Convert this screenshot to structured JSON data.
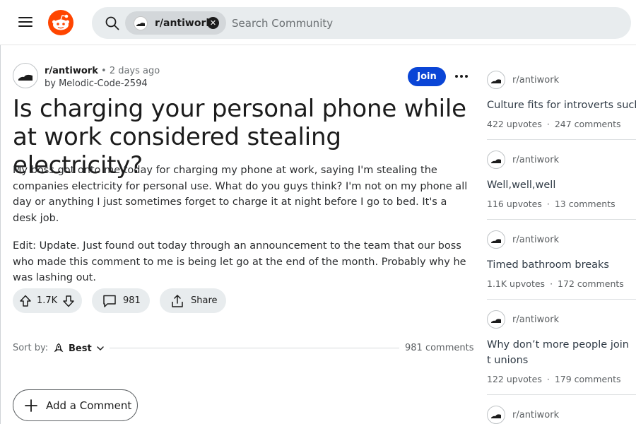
{
  "search": {
    "community_chip": "r/antiwork",
    "placeholder": "Search Community"
  },
  "post": {
    "subreddit": "r/antiwork",
    "separator": "•",
    "time": "2 days ago",
    "author": "by Melodic-Code-2594",
    "join_label": "Join",
    "title": "Is charging your personal phone while at work considered stealing electricity?",
    "body": [
      "My boss got onto me today for charging my phone at work, saying I'm stealing the companies electricity for personal use. What do you guys think? I'm not on my phone all day or anything I just sometimes forget to charge it at night before I go to bed. It's a desk job.",
      "Edit: Update. Just found out today through an announcement to the team that our boss who made this comment to me is being let go at the end of the month. Probably why he was lashing out."
    ],
    "upvotes": "1.7K",
    "comments_count": "981",
    "share_label": "Share"
  },
  "sort": {
    "label": "Sort by:",
    "value": "Best",
    "total_comments": "981 comments"
  },
  "add_comment_label": "Add a Comment",
  "related": [
    {
      "subreddit": "r/antiwork",
      "title": "Culture fits for introverts suck",
      "upvotes": "422 upvotes",
      "comments": "247 comments"
    },
    {
      "subreddit": "r/antiwork",
      "title": "Well,well,well",
      "upvotes": "116 upvotes",
      "comments": "13 comments"
    },
    {
      "subreddit": "r/antiwork",
      "title": "Timed bathroom breaks",
      "upvotes": "1.1K upvotes",
      "comments": "172 comments"
    },
    {
      "subreddit": "r/antiwork",
      "title": "Why don’t more people join t unions",
      "upvotes": "122 upvotes",
      "comments": "179 comments"
    },
    {
      "subreddit": "r/antiwork"
    }
  ],
  "stats_separator": "·",
  "colors": {
    "brand": "#ff4500",
    "join_button": "#0a45d6",
    "pill_bg": "#e8ecee"
  }
}
